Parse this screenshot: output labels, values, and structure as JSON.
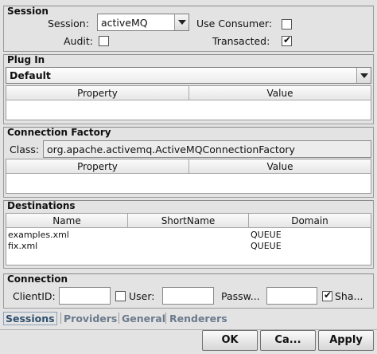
{
  "session": {
    "title": "Session",
    "session_label": "Session:",
    "session_value": "activeMQ",
    "use_consumer_label": "Use Consumer:",
    "use_consumer_checked": false,
    "audit_label": "Audit:",
    "audit_checked": false,
    "transacted_label": "Transacted:",
    "transacted_checked": true
  },
  "plugin": {
    "title": "Plug In",
    "selected": "Default",
    "columns": [
      "Property",
      "Value"
    ]
  },
  "connection_factory": {
    "title": "Connection Factory",
    "class_label": "Class:",
    "class_value": "org.apache.activemq.ActiveMQConnectionFactory",
    "columns": [
      "Property",
      "Value"
    ]
  },
  "destinations": {
    "title": "Destinations",
    "columns": [
      "Name",
      "ShortName",
      "Domain"
    ],
    "rows": [
      {
        "name": "examples.xml",
        "shortname": "",
        "domain": "QUEUE"
      },
      {
        "name": "fix.xml",
        "shortname": "",
        "domain": "QUEUE"
      }
    ]
  },
  "connection": {
    "title": "Connection",
    "clientid_label": "ClientID:",
    "clientid_value": "",
    "user_label": "User:",
    "user_checked": false,
    "user_value": "",
    "password_label": "Passw...",
    "password_value": "",
    "shared_label": "Sha...",
    "shared_checked": true
  },
  "tabs": [
    "Sessions",
    "Providers",
    "General",
    "Renderers"
  ],
  "active_tab": "Sessions",
  "buttons": {
    "ok": "OK",
    "cancel": "Ca...",
    "apply": "Apply"
  }
}
